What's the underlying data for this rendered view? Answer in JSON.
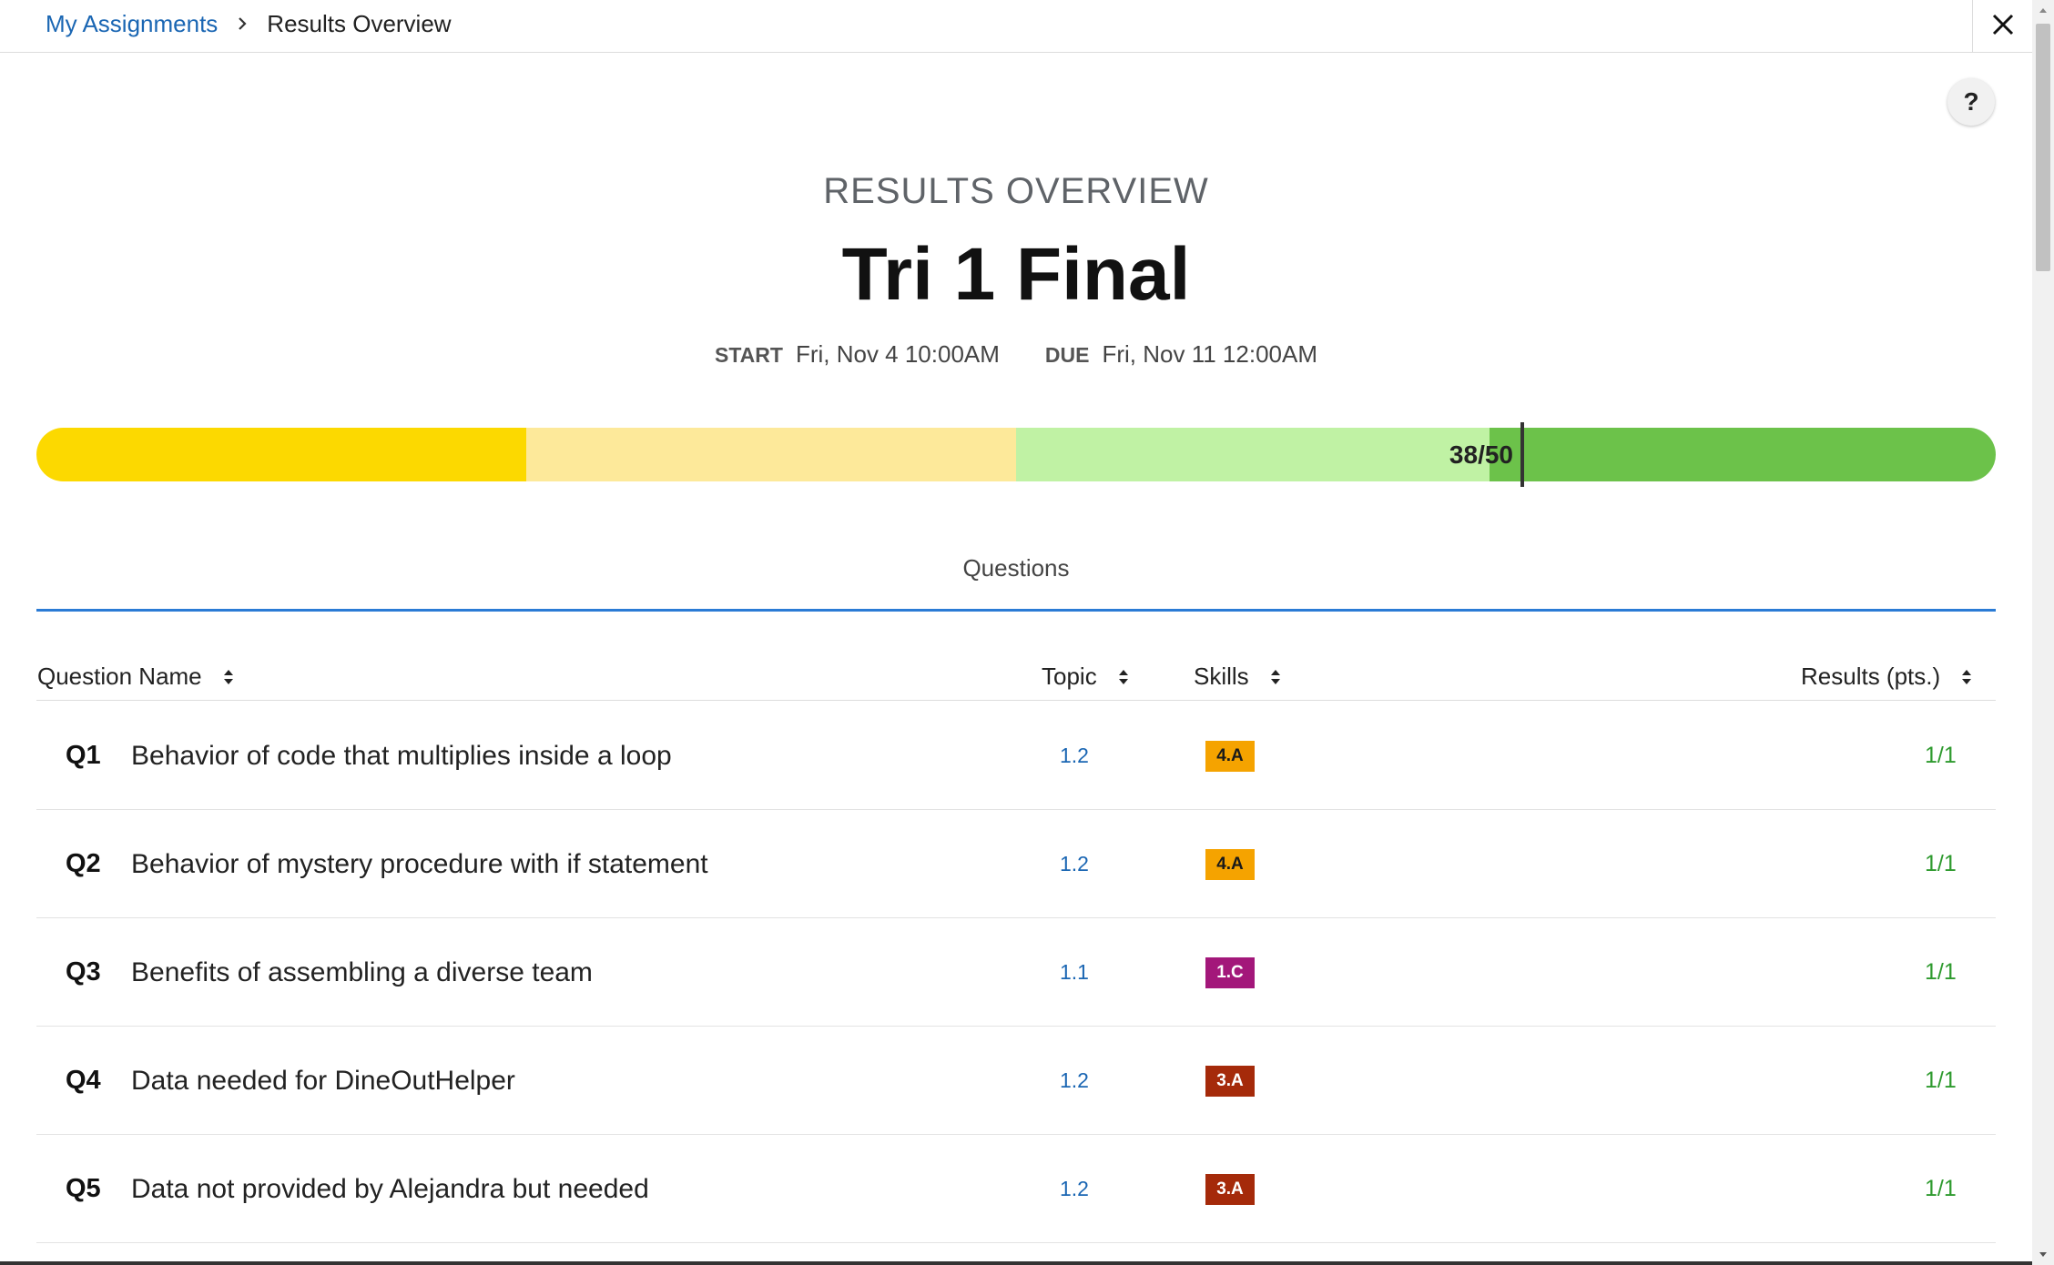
{
  "breadcrumb": {
    "parent": "My Assignments",
    "current": "Results Overview"
  },
  "header": {
    "overview_label": "RESULTS OVERVIEW",
    "title": "Tri 1 Final",
    "start_label": "START",
    "start_value": "Fri, Nov 4 10:00AM",
    "due_label": "DUE",
    "due_value": "Fri, Nov 11 12:00AM"
  },
  "score": {
    "text": "38/50",
    "earned": 38,
    "total": 50,
    "segment_colors": [
      "#fcd900",
      "#fde99a",
      "#c0f2a4",
      "#6cc24a"
    ]
  },
  "tabs": {
    "questions": "Questions"
  },
  "table": {
    "headers": {
      "question_name": "Question Name",
      "topic": "Topic",
      "skills": "Skills",
      "results": "Results (pts.)"
    },
    "rows": [
      {
        "num": "Q1",
        "name": "Behavior of code that multiplies inside a loop",
        "topic": "1.2",
        "skill": "4.A",
        "result": "1/1"
      },
      {
        "num": "Q2",
        "name": "Behavior of mystery procedure with if statement",
        "topic": "1.2",
        "skill": "4.A",
        "result": "1/1"
      },
      {
        "num": "Q3",
        "name": "Benefits of assembling a diverse team",
        "topic": "1.1",
        "skill": "1.C",
        "result": "1/1"
      },
      {
        "num": "Q4",
        "name": "Data needed for DineOutHelper",
        "topic": "1.2",
        "skill": "3.A",
        "result": "1/1"
      },
      {
        "num": "Q5",
        "name": "Data not provided by Alejandra but needed",
        "topic": "1.2",
        "skill": "3.A",
        "result": "1/1"
      }
    ]
  },
  "skill_colors": {
    "4.A": {
      "bg": "#f5a300",
      "fg": "#1a1a1a"
    },
    "1.C": {
      "bg": "#a3177a",
      "fg": "#ffffff"
    },
    "3.A": {
      "bg": "#a52a0a",
      "fg": "#ffffff"
    }
  },
  "icons": {
    "breadcrumb_separator": "chevron-right-icon",
    "close": "close-icon",
    "help": "?",
    "sort": "sort-icon"
  }
}
